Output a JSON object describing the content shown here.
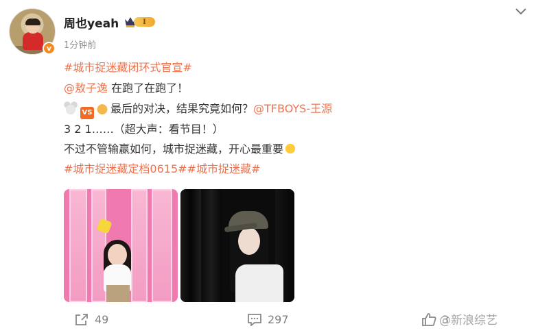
{
  "post": {
    "username": "周也yeah",
    "vip_level": "I",
    "verified_mark": "v",
    "timestamp": "1分钟前",
    "lines": {
      "l1_hashtag": "#城市捉迷藏闭环式官宣#",
      "l2_mention": "@敖子逸",
      "l2_text": " 在跑了在跑了！",
      "l3_vs": "VS",
      "l3_text": "最后的对决，结果究竟如何？",
      "l3_mention": "@TFBOYS-王源",
      "l4_text": "3 2 1……（超大声：看节目！）",
      "l5_text": "不过不管输赢如何，城市捉迷藏，开心最重要",
      "l6_hashtag1": "#城市捉迷藏定档0615#",
      "l6_hashtag2": "#城市捉迷藏#"
    }
  },
  "footer": {
    "share_count": "49",
    "comment_count": "297",
    "like_count": "3"
  },
  "watermark": "@新浪综艺",
  "colors": {
    "hashtag": "#eb7350",
    "verified": "#f58a1f",
    "vip_gold": "#f0a92a"
  },
  "icons": [
    "chevron-down-icon",
    "share-icon",
    "comment-icon",
    "like-icon",
    "crown-icon",
    "verified-icon"
  ]
}
